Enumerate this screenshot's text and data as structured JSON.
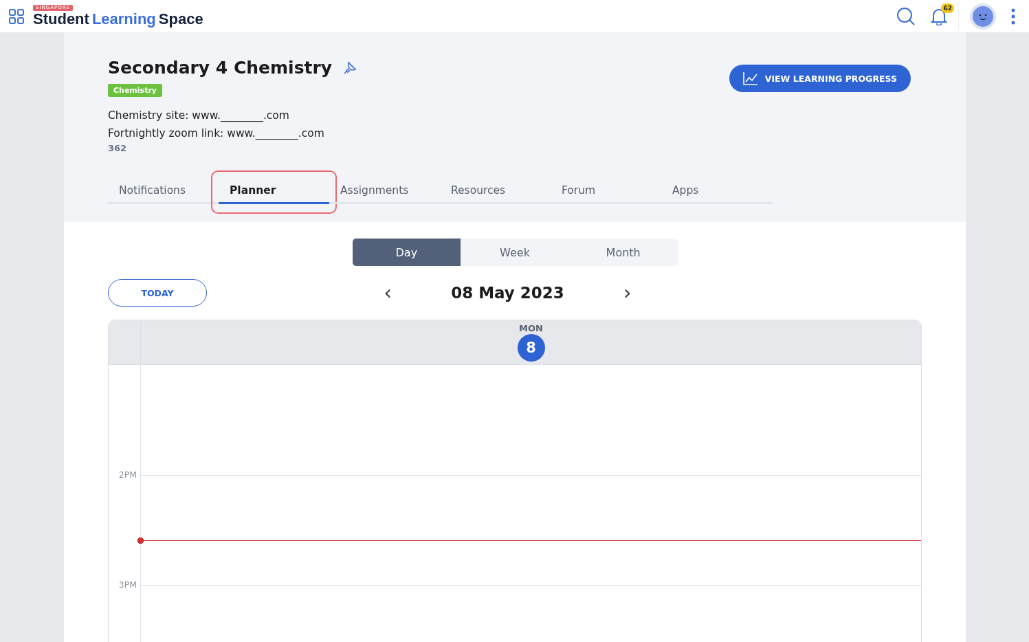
{
  "header": {
    "logo_tag": "SINGAPORE",
    "logo_parts": [
      {
        "text": "Student",
        "kind": "dark"
      },
      {
        "text": "Learning",
        "kind": "accent"
      },
      {
        "text": "Space",
        "kind": "dark"
      }
    ],
    "notification_count": "62"
  },
  "course": {
    "title": "Secondary 4 Chemistry",
    "tag": "Chemistry",
    "description_lines": [
      "Chemistry site: www.________.com",
      "Fortnightly zoom link: www.________.com"
    ],
    "count": "362",
    "progress_button": "VIEW LEARNING PROGRESS"
  },
  "tabs": [
    {
      "label": "Notifications",
      "selected": false
    },
    {
      "label": "Planner",
      "selected": true
    },
    {
      "label": "Assignments",
      "selected": false
    },
    {
      "label": "Resources",
      "selected": false
    },
    {
      "label": "Forum",
      "selected": false
    },
    {
      "label": "Apps",
      "selected": false
    }
  ],
  "views": [
    {
      "label": "Day",
      "selected": true
    },
    {
      "label": "Week",
      "selected": false
    },
    {
      "label": "Month",
      "selected": false
    }
  ],
  "planner": {
    "today_button": "TODAY",
    "prev": "‹",
    "date": "08 May 2023",
    "next": "›",
    "day_name": "MON",
    "day_number": "8",
    "hours": [
      "2PM",
      "3PM"
    ]
  }
}
